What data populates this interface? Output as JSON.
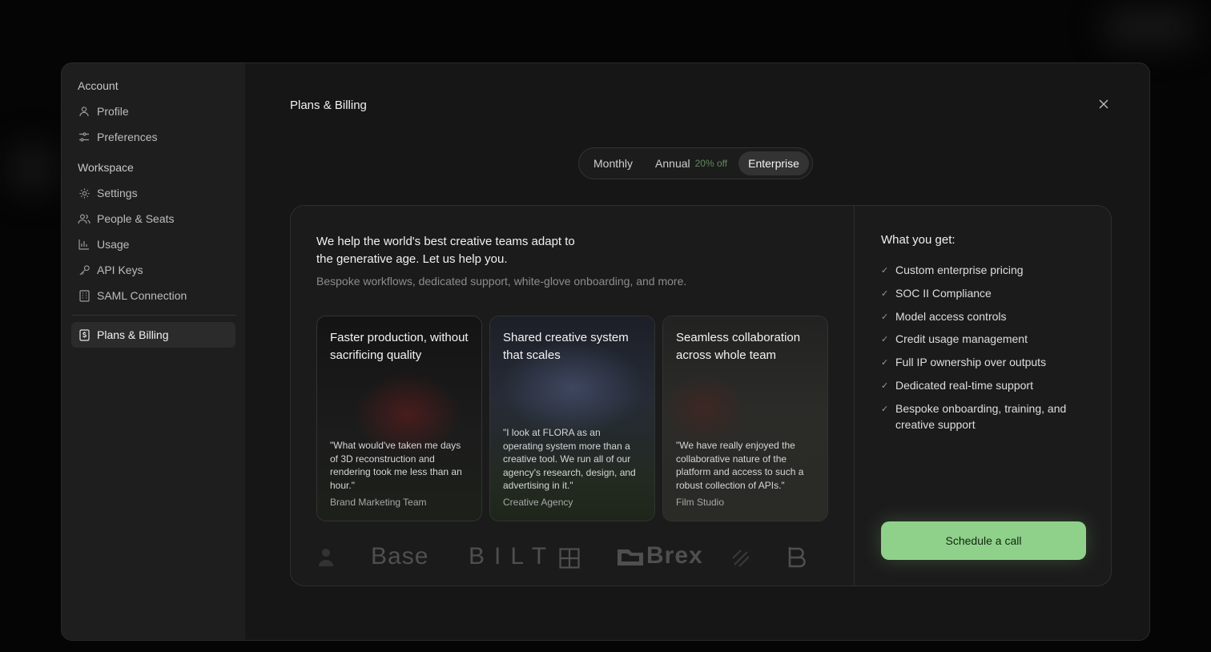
{
  "sidebar": {
    "account_title": "Account",
    "account_items": [
      {
        "label": "Profile",
        "icon": "user-icon"
      },
      {
        "label": "Preferences",
        "icon": "sliders-icon"
      }
    ],
    "workspace_title": "Workspace",
    "workspace_items": [
      {
        "label": "Settings",
        "icon": "gear-icon"
      },
      {
        "label": "People & Seats",
        "icon": "users-icon"
      },
      {
        "label": "Usage",
        "icon": "bar-chart-icon"
      },
      {
        "label": "API Keys",
        "icon": "key-icon"
      },
      {
        "label": "SAML Connection",
        "icon": "building-icon"
      }
    ],
    "billing_item": {
      "label": "Plans & Billing",
      "icon": "dollar-file-icon",
      "active": true
    }
  },
  "header": {
    "title": "Plans & Billing"
  },
  "plan_toggle": {
    "monthly": "Monthly",
    "annual": "Annual",
    "annual_discount": "20% off",
    "enterprise": "Enterprise",
    "selected": "Enterprise"
  },
  "enterprise": {
    "headline": "We help the world's best creative teams adapt to the generative age. Let us help you.",
    "subheadline": "Bespoke workflows, dedicated support, white-glove onboarding, and more.",
    "cards": [
      {
        "title": "Faster production, without sacrificing quality",
        "quote": "\"What would've taken me days of 3D reconstruction and rendering took me less than an hour.\"",
        "source": "Brand Marketing Team"
      },
      {
        "title": "Shared creative system that scales",
        "quote": "\"I look at FLORA as an operating system more than a creative tool. We run all of our agency's research, design, and advertising in it.\"",
        "source": "Creative Agency"
      },
      {
        "title": "Seamless collaboration across whole team",
        "quote": "\"We have really enjoyed the collaborative nature of the platform and access to such a robust collection of APIs.\"",
        "source": "Film Studio"
      }
    ],
    "logos": [
      "Base",
      "BILT",
      "Brex"
    ],
    "what_you_get_title": "What you get:",
    "features": [
      "Custom enterprise pricing",
      "SOC II Compliance",
      "Model access controls",
      "Credit usage management",
      "Full IP ownership over outputs",
      "Dedicated real-time support",
      "Bespoke onboarding, training, and creative support"
    ],
    "cta_label": "Schedule a call"
  },
  "colors": {
    "accent_green": "#8fd18a",
    "discount_green": "#5f8a5a",
    "modal_bg": "#161616",
    "sidebar_bg": "#1e1e1e"
  }
}
